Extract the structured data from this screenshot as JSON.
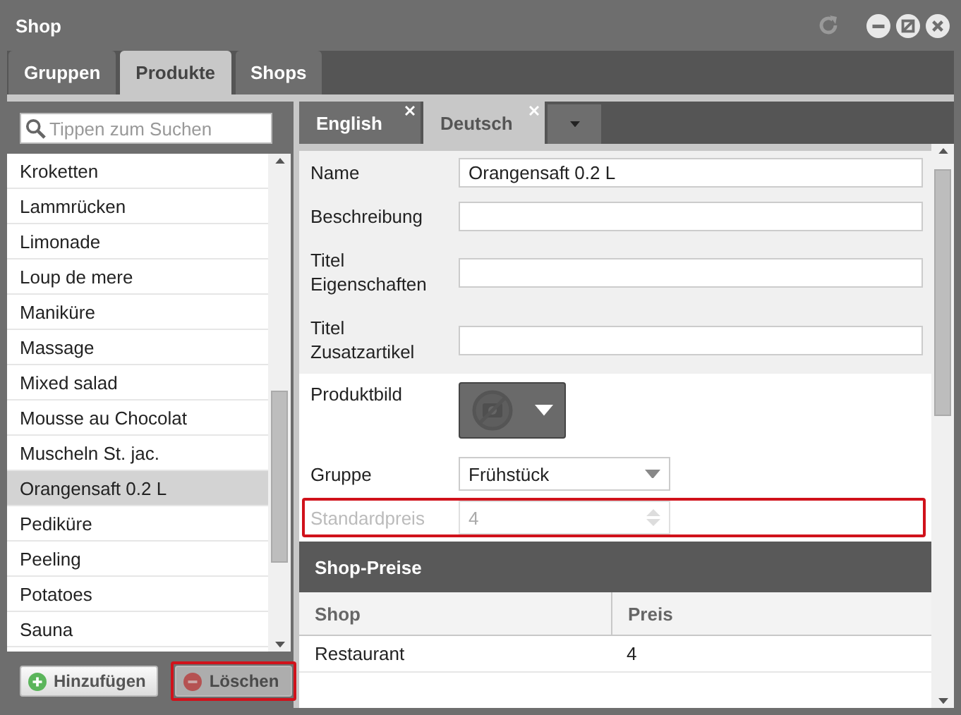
{
  "window": {
    "title": "Shop"
  },
  "tabs": [
    {
      "label": "Gruppen",
      "selected": false
    },
    {
      "label": "Produkte",
      "selected": true
    },
    {
      "label": "Shops",
      "selected": false
    }
  ],
  "search": {
    "placeholder": "Tippen zum Suchen"
  },
  "products": [
    {
      "label": "Kroketten",
      "selected": false
    },
    {
      "label": "Lammrücken",
      "selected": false
    },
    {
      "label": "Limonade",
      "selected": false
    },
    {
      "label": "Loup de mere",
      "selected": false
    },
    {
      "label": "Maniküre",
      "selected": false
    },
    {
      "label": "Massage",
      "selected": false
    },
    {
      "label": "Mixed salad",
      "selected": false
    },
    {
      "label": "Mousse au Chocolat",
      "selected": false
    },
    {
      "label": "Muscheln St. jac.",
      "selected": false
    },
    {
      "label": "Orangensaft 0.2 L",
      "selected": true
    },
    {
      "label": "Pediküre",
      "selected": false
    },
    {
      "label": "Peeling",
      "selected": false
    },
    {
      "label": "Potatoes",
      "selected": false
    },
    {
      "label": "Sauna",
      "selected": false
    }
  ],
  "buttons": [
    {
      "label": "Hinzufügen",
      "kind": "add",
      "disabled": false,
      "highlighted": false
    },
    {
      "label": "Löschen",
      "kind": "delete",
      "disabled": true,
      "highlighted": true
    }
  ],
  "languages": [
    {
      "label": "English",
      "selected": false
    },
    {
      "label": "Deutsch",
      "selected": true
    }
  ],
  "form": [
    {
      "kind": "text",
      "label": "Name",
      "value": "Orangensaft 0.2 L",
      "shaded": true,
      "disabled": false,
      "highlighted": false
    },
    {
      "kind": "text",
      "label": "Beschreibung",
      "shaded": true,
      "disabled": false,
      "highlighted": false
    },
    {
      "kind": "text",
      "label": "Titel\nEigenschaften",
      "shaded": true,
      "disabled": false,
      "highlighted": false
    },
    {
      "kind": "text",
      "label": "Titel\nZusatzartikel",
      "shaded": true,
      "disabled": false,
      "highlighted": false
    },
    {
      "kind": "image",
      "label": "Produktbild",
      "shaded": false,
      "disabled": false,
      "highlighted": false
    },
    {
      "kind": "select",
      "label": "Gruppe",
      "value": "Frühstück",
      "shaded": false,
      "disabled": false,
      "highlighted": false
    },
    {
      "kind": "number",
      "label": "Standardpreis",
      "value": "4",
      "shaded": false,
      "disabled": true,
      "highlighted": true
    }
  ],
  "shop_prices": {
    "title": "Shop-Preise",
    "columns": [
      "Shop",
      "Preis"
    ],
    "rows": [
      [
        "Restaurant",
        "4"
      ]
    ]
  }
}
